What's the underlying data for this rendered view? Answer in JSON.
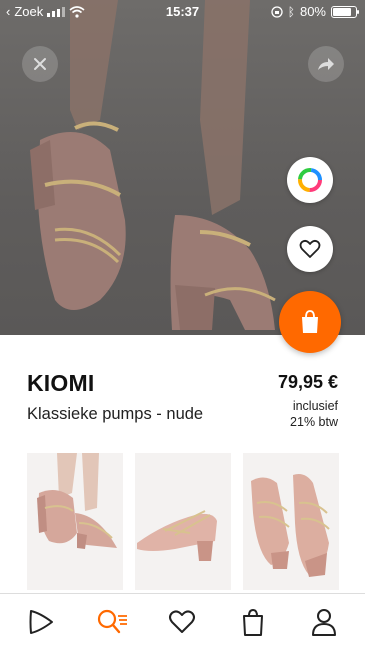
{
  "status_bar": {
    "back_label": "Zoek",
    "time": "15:37",
    "battery": "80%",
    "battery_level": 0.8
  },
  "product": {
    "brand": "KIOMI",
    "name": "Klassieke pumps - nude",
    "price": "79,95 €",
    "vat_line1": "inclusief",
    "vat_line2": "21% btw"
  },
  "icons": {
    "close": "close-icon",
    "share": "share-arrow-icon",
    "color": "color-wheel-icon",
    "wishlist": "heart-icon",
    "add_to_bag": "shopping-bag-icon"
  },
  "tabs": [
    {
      "icon": "home-logo-icon",
      "active": false
    },
    {
      "icon": "search-list-icon",
      "active": true
    },
    {
      "icon": "heart-icon",
      "active": false
    },
    {
      "icon": "shopping-bag-icon",
      "active": false
    },
    {
      "icon": "profile-icon",
      "active": false
    }
  ],
  "colors": {
    "accent": "#ff6900",
    "hero_overlay": "#5f5d5c",
    "shoe_nude": "#c9a29a"
  }
}
